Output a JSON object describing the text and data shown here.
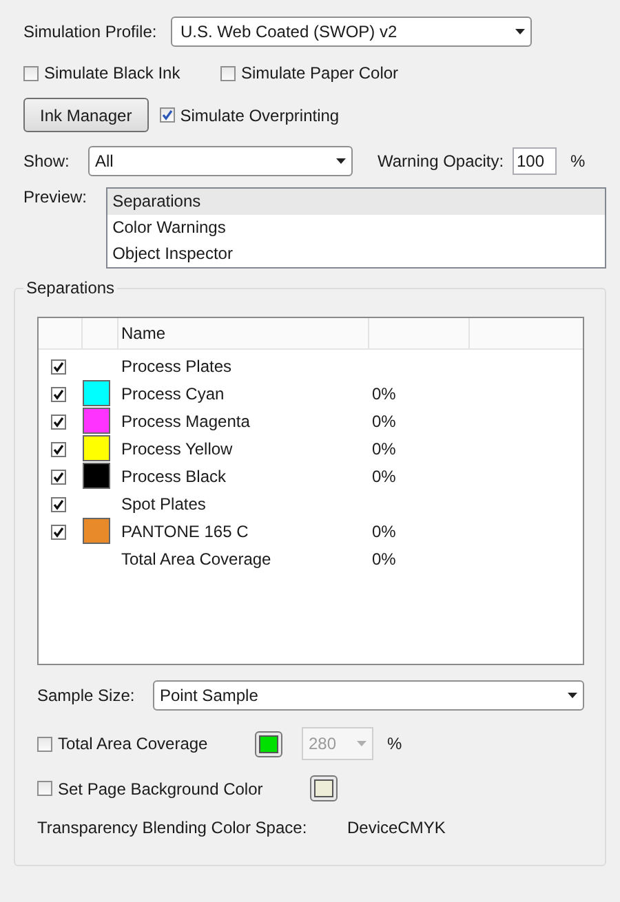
{
  "simulation_profile": {
    "label": "Simulation Profile:",
    "value": "U.S. Web Coated (SWOP) v2"
  },
  "options": [
    {
      "label": "Simulate Black Ink",
      "checked": false
    },
    {
      "label": "Simulate Paper Color",
      "checked": false
    }
  ],
  "ink_manager_button": "Ink Manager",
  "simulate_overprinting": {
    "label": "Simulate Overprinting",
    "checked": true
  },
  "show": {
    "label": "Show:",
    "value": "All"
  },
  "warning_opacity": {
    "label": "Warning Opacity:",
    "value": "100",
    "unit": "%"
  },
  "preview": {
    "label": "Preview:",
    "items": [
      {
        "label": "Separations",
        "selected": true
      },
      {
        "label": "Color Warnings",
        "selected": false
      },
      {
        "label": "Object Inspector",
        "selected": false
      }
    ]
  },
  "separations": {
    "title": "Separations",
    "columns": [
      "Name"
    ],
    "rows": [
      {
        "kind": "group",
        "name": "Process Plates",
        "checked": true
      },
      {
        "kind": "ink",
        "name": "Process Cyan",
        "checked": true,
        "color": "#00ffff",
        "coverage": "0%"
      },
      {
        "kind": "ink",
        "name": "Process Magenta",
        "checked": true,
        "color": "#ff33ff",
        "coverage": "0%"
      },
      {
        "kind": "ink",
        "name": "Process Yellow",
        "checked": true,
        "color": "#ffff00",
        "coverage": "0%"
      },
      {
        "kind": "ink",
        "name": "Process Black",
        "checked": true,
        "color": "#000000",
        "coverage": "0%"
      },
      {
        "kind": "group",
        "name": "Spot Plates",
        "checked": true
      },
      {
        "kind": "ink",
        "name": "PANTONE 165 C",
        "checked": true,
        "color": "#e8892a",
        "coverage": "0%"
      },
      {
        "kind": "total",
        "name": "Total Area Coverage",
        "coverage": "0%"
      }
    ]
  },
  "sample_size": {
    "label": "Sample Size:",
    "value": "Point Sample"
  },
  "total_area_coverage": {
    "label": "Total Area Coverage",
    "checked": false,
    "color": "#00e000",
    "value": "280",
    "disabled": true,
    "unit": "%"
  },
  "page_background": {
    "label": "Set Page Background Color",
    "checked": false,
    "color": "#eeeed8"
  },
  "blending": {
    "label": "Transparency Blending Color Space:",
    "value": "DeviceCMYK"
  }
}
